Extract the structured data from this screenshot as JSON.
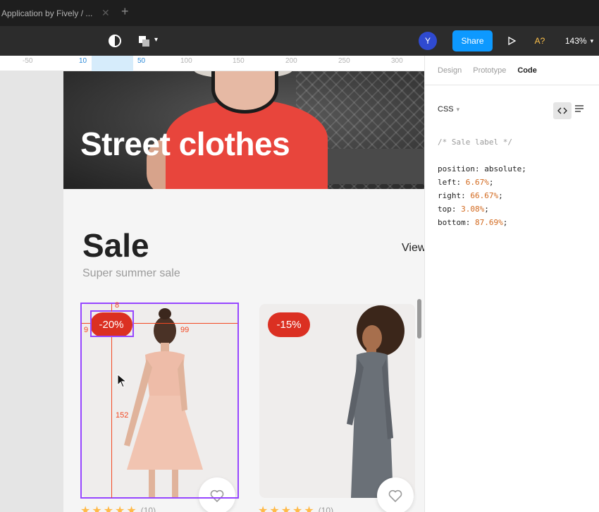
{
  "window": {
    "tab_title": "Application by Fively / ...",
    "close_glyph": "✕",
    "add_glyph": "+"
  },
  "toolbar": {
    "avatar_initial": "Y",
    "share_label": "Share",
    "a11y_label": "A?",
    "zoom_label": "143%"
  },
  "ruler": {
    "ticks": [
      "-50",
      "10",
      "50",
      "100",
      "150",
      "200",
      "250",
      "300"
    ]
  },
  "canvas": {
    "hero_title": "Street clothes",
    "sale_title": "Sale",
    "sale_subtitle": "Super summer sale",
    "view_all": "View",
    "products": [
      {
        "badge": "-20%",
        "rating_count": "(10)"
      },
      {
        "badge": "-15%",
        "rating_count": "(10)"
      }
    ],
    "measurements": {
      "top": "8",
      "left": "9",
      "right": "99",
      "bottom": "152"
    }
  },
  "panel": {
    "tabs": [
      "Design",
      "Prototype",
      "Code"
    ],
    "active_tab": "Code",
    "language": "CSS",
    "code_comment": "/* Sale label */",
    "properties": [
      {
        "name": "position",
        "value": "absolute"
      },
      {
        "name": "left",
        "value": "6.67%"
      },
      {
        "name": "right",
        "value": "66.67%"
      },
      {
        "name": "top",
        "value": "3.08%"
      },
      {
        "name": "bottom",
        "value": "87.69%"
      }
    ]
  },
  "colors": {
    "accent": "#0d99ff",
    "sale_red": "#db3022",
    "selection": "#9747ff",
    "measure": "#f24822",
    "star": "#ffba49"
  },
  "icons": [
    "contrast-icon",
    "shapes-icon",
    "play-icon",
    "heart-icon",
    "star-icon",
    "code-icon",
    "menu-icon",
    "cursor-icon"
  ]
}
